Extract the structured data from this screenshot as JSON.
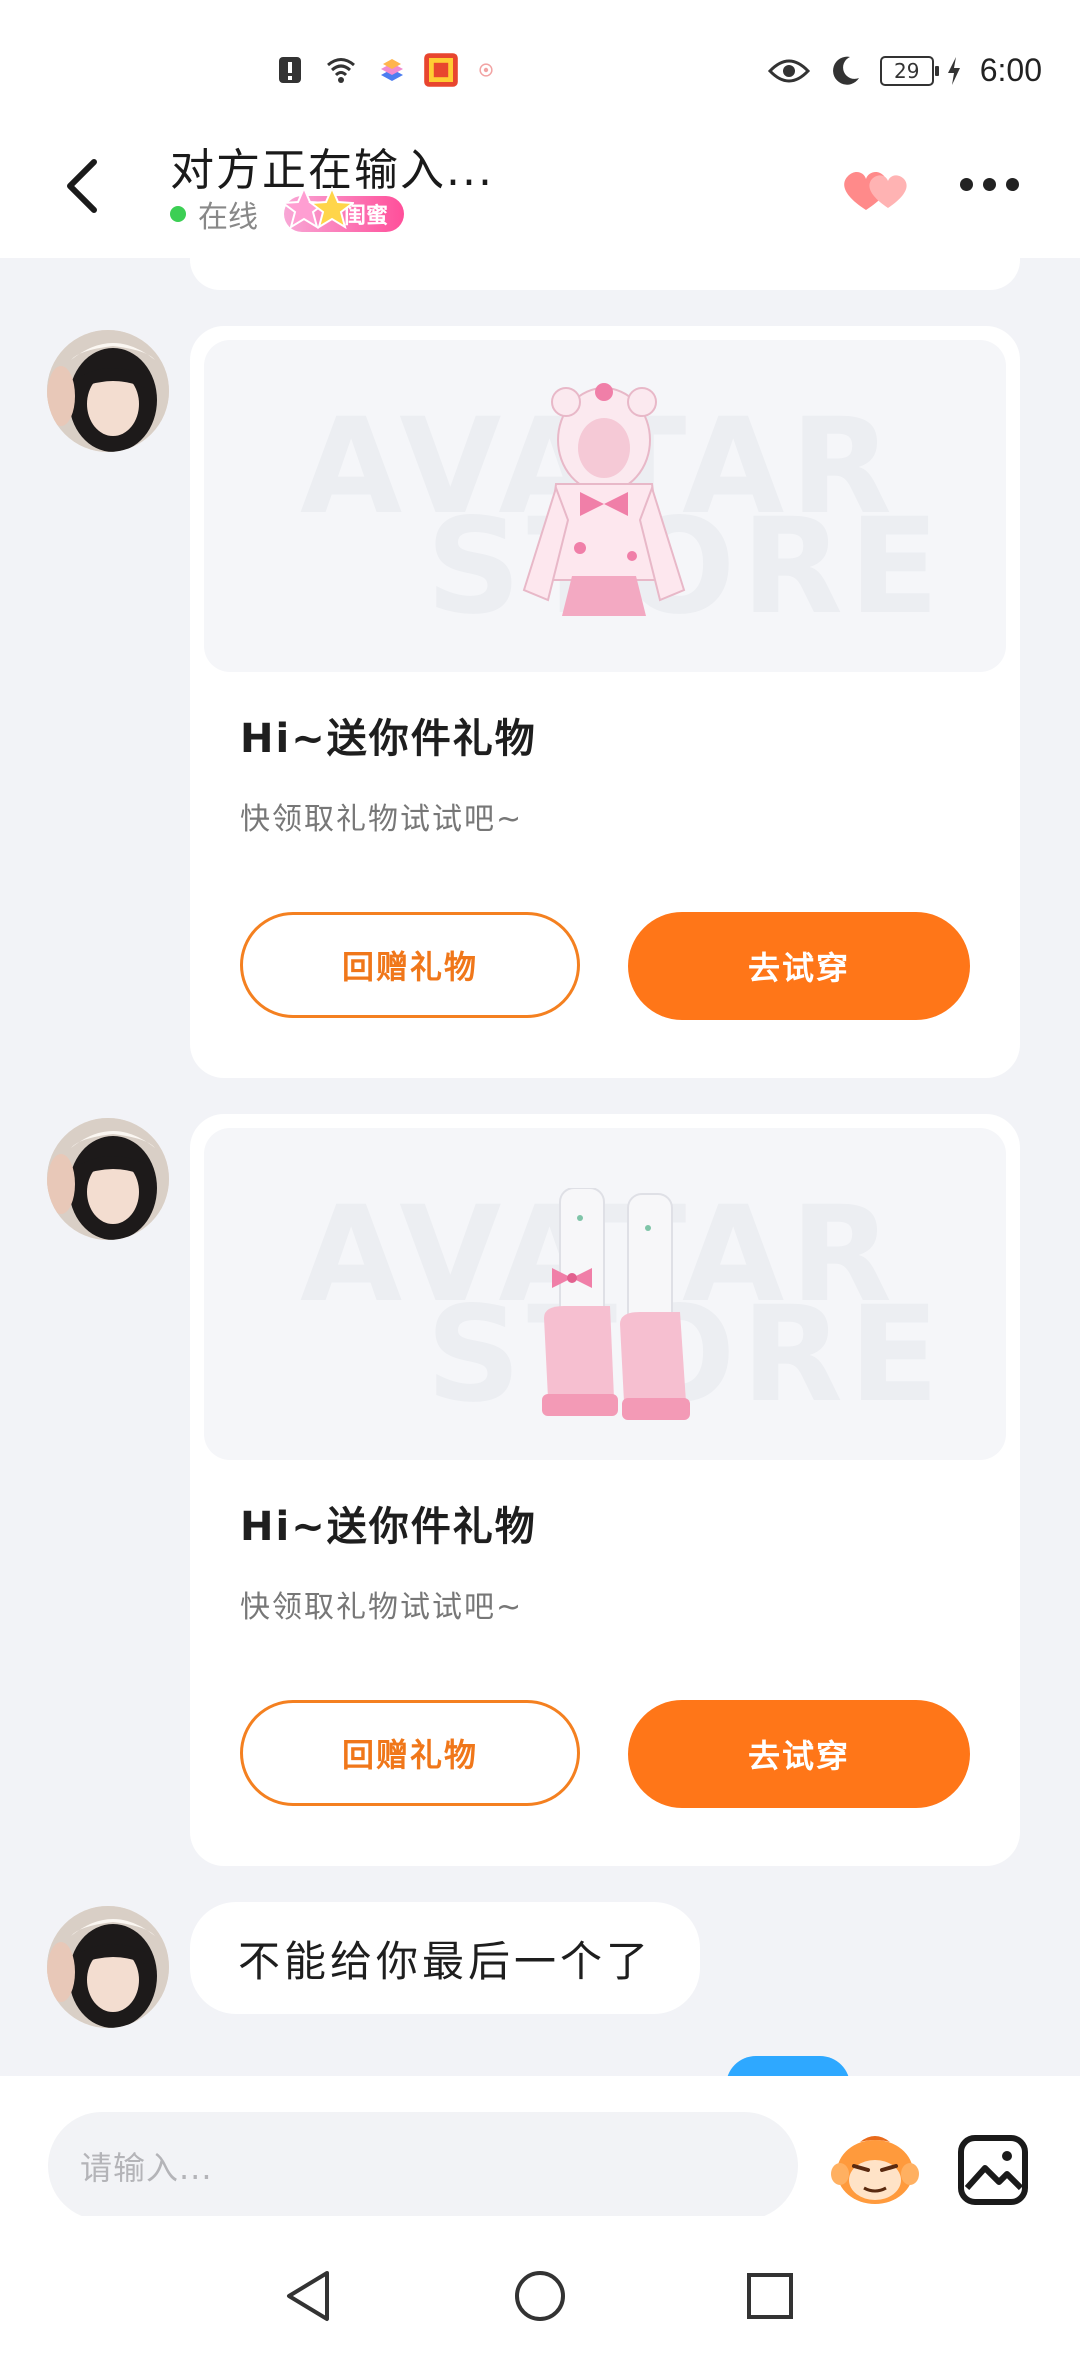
{
  "status_bar": {
    "battery": "29",
    "time": "6:00"
  },
  "header": {
    "title": "对方正在输入...",
    "online_text": "在线",
    "friend_tag": "闺蜜"
  },
  "chat": {
    "watermark_line1": "AVATAR",
    "watermark_line2": "STORE",
    "gift_cards": [
      {
        "item": "pink-bear-hoodie-outfit",
        "title": "Hi~送你件礼物",
        "subtitle": "快领取礼物试试吧~",
        "return_gift_label": "回赠礼物",
        "try_on_label": "去试穿"
      },
      {
        "item": "pink-bow-boots",
        "title": "Hi~送你件礼物",
        "subtitle": "快领取礼物试试吧~",
        "return_gift_label": "回赠礼物",
        "try_on_label": "去试穿"
      }
    ],
    "text_message": "不能给你最后一个了"
  },
  "input_bar": {
    "placeholder": "请输入..."
  },
  "colors": {
    "accent_orange": "#ff7618",
    "online_green": "#3ccf54",
    "friend_tag_pink": "#ff4f9a",
    "background": "#f2f3f7"
  }
}
